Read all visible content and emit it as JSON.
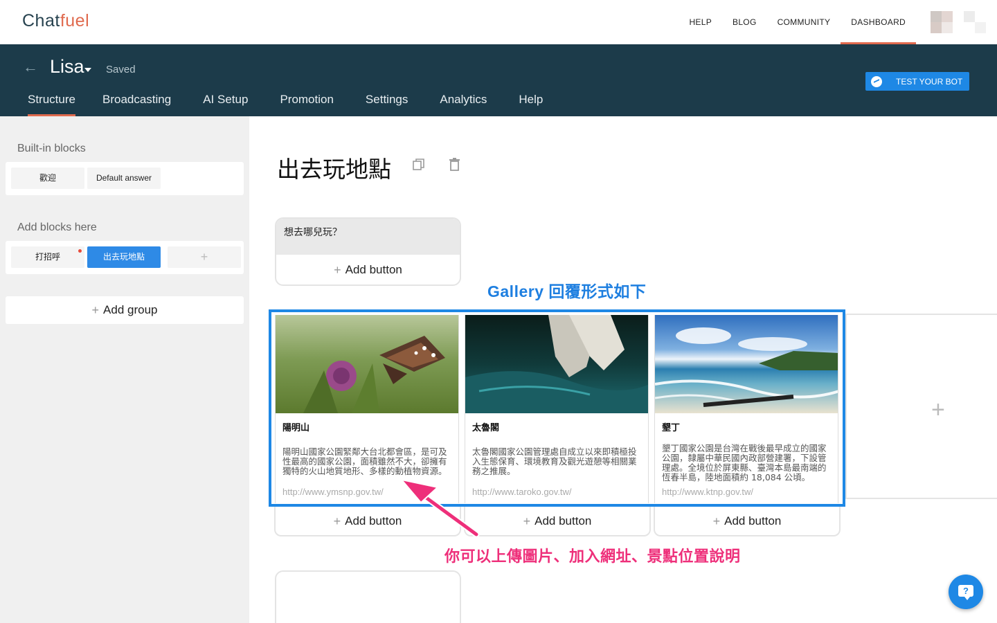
{
  "logo": {
    "part1": "Chat",
    "part2": "fuel"
  },
  "topnav": {
    "items": [
      "HELP",
      "BLOG",
      "COMMUNITY",
      "DASHBOARD"
    ],
    "active": "DASHBOARD"
  },
  "bot": {
    "name": "Lisa",
    "status": "Saved",
    "test_button": "TEST YOUR BOT"
  },
  "tabs": [
    "Structure",
    "Broadcasting",
    "AI Setup",
    "Promotion",
    "Settings",
    "Analytics",
    "Help"
  ],
  "sidebar": {
    "builtin_title": "Built-in blocks",
    "builtin_blocks": [
      "歡迎",
      "Default answer"
    ],
    "add_title": "Add blocks here",
    "add_blocks": [
      "打招呼",
      "出去玩地點"
    ],
    "add_plus": "+",
    "add_group": "Add group"
  },
  "block": {
    "title": "出去玩地點",
    "text_message": "想去哪兒玩？",
    "add_button": "Add button"
  },
  "gallery": [
    {
      "title": "陽明山",
      "subtitle": "陽明山國家公園緊鄰大台北都會區，是可及性最高的國家公園，面積雖然不大，卻擁有獨特的火山地質地形、多樣的動植物資源。",
      "url": "http://www.ymsnp.gov.tw/",
      "add_button": "Add button"
    },
    {
      "title": "太魯閣",
      "subtitle": "太魯閣國家公園管理處自成立以來即積極投入生態保育、環境教育及觀光遊憩等相關業務之推展。",
      "url": "http://www.taroko.gov.tw/",
      "add_button": "Add button"
    },
    {
      "title": "墾丁",
      "subtitle": "墾丁國家公園是台灣在戰後最早成立的國家公園，隸屬中華民國內政部營建署，下設管理處。全境位於屏東縣、臺灣本島最南端的恆春半島，陸地面積約 18,084 公頃。",
      "url": "http://www.ktnp.gov.tw/",
      "add_button": "Add button"
    }
  ],
  "annotations": {
    "gallery_note": "Gallery 回覆形式如下",
    "upload_note": "你可以上傳圖片、加入網址、景點位置說明"
  },
  "colors": {
    "brand_dark": "#1c3b4a",
    "accent": "#e06a4e",
    "primary": "#1e88e5",
    "annotation_pink": "#ee2f7a"
  },
  "help_fab": "?"
}
